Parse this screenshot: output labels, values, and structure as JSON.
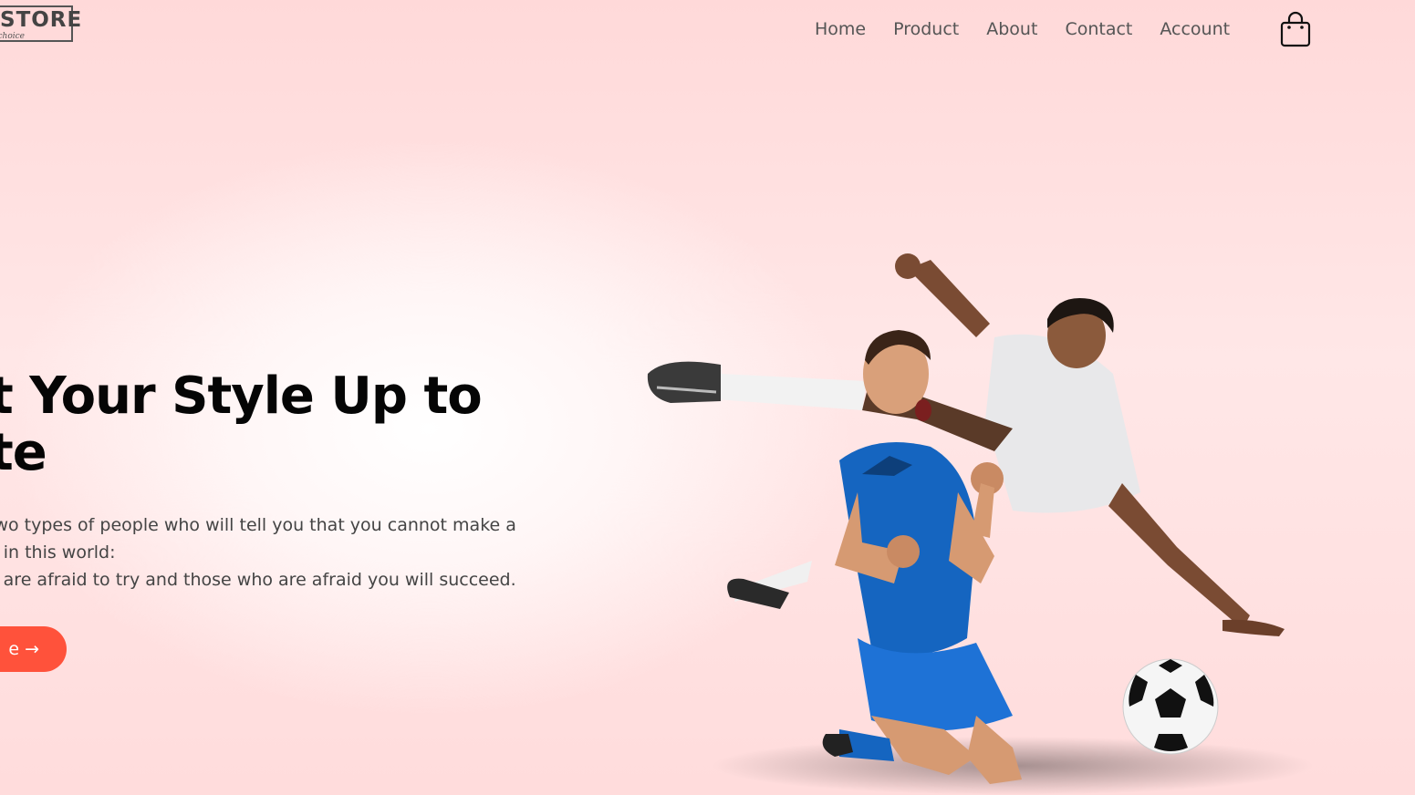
{
  "logo": {
    "text": "STORE",
    "tagline": "s choice"
  },
  "nav": {
    "items": [
      "Home",
      "Product",
      "About",
      "Contact",
      "Account"
    ],
    "cart_icon": "shopping-bag-icon"
  },
  "hero": {
    "headline_line1": "t Your Style Up to",
    "headline_line2": "te",
    "description_line1": "two types of people who will tell you that you cannot make a",
    "description_line2": "e in this world:",
    "description_line3": "o are afraid to try and those who are afraid you will succeed.",
    "cta_label": "e →",
    "image": "footballers-celebrating"
  },
  "colors": {
    "accent": "#ff523b",
    "headline": "#050505",
    "nav_text": "#555555",
    "background": "#ffe3e3"
  }
}
